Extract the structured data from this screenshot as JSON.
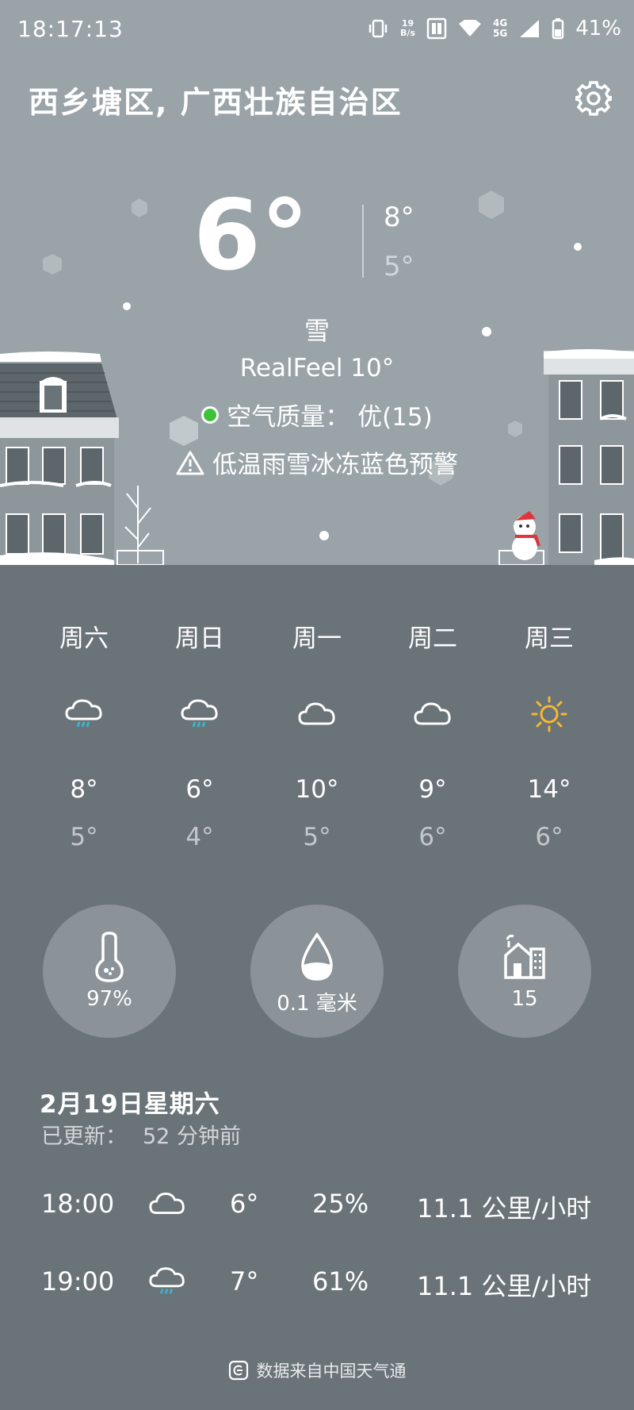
{
  "status": {
    "time": "18:17:13",
    "net_top": "19",
    "net_bottom": "B/s",
    "lte_top": "4G",
    "lte_bottom": "5G",
    "battery": "41%"
  },
  "header": {
    "location": "西乡塘区, 广西壮族自治区"
  },
  "current": {
    "temp": "6°",
    "high": "8°",
    "low": "5°",
    "condition": "雪",
    "realfeel": "RealFeel 10°",
    "air_quality": "空气质量： 优(15)",
    "warning": "低温雨雪冰冻蓝色预警"
  },
  "forecast": [
    {
      "day": "周六",
      "icon": "rain-icon",
      "high": "8°",
      "low": "5°"
    },
    {
      "day": "周日",
      "icon": "rain-icon",
      "high": "6°",
      "low": "4°"
    },
    {
      "day": "周一",
      "icon": "cloud-icon",
      "high": "10°",
      "low": "5°"
    },
    {
      "day": "周二",
      "icon": "cloud-icon",
      "high": "9°",
      "low": "6°"
    },
    {
      "day": "周三",
      "icon": "sun-icon",
      "high": "14°",
      "low": "6°"
    }
  ],
  "metrics": {
    "humidity": "97%",
    "precipitation": "0.1 毫米",
    "aqi": "15"
  },
  "today": {
    "date": "2月19日星期六",
    "updated_label": "已更新：",
    "updated_value": "52 分钟前"
  },
  "hourly": [
    {
      "time": "18:00",
      "icon": "cloud-icon",
      "temp": "6°",
      "pct": "25%",
      "wind": "11.1 公里/小时"
    },
    {
      "time": "19:00",
      "icon": "rain-icon",
      "temp": "7°",
      "pct": "61%",
      "wind": "11.1 公里/小时"
    }
  ],
  "footer": {
    "source": "数据来自中国天气通"
  },
  "colors": {
    "sky": "#99a3a8",
    "ground": "#6a7378",
    "circle": "#8b9398",
    "rain_drops": "#3cb4c8",
    "sun": "#f6b830",
    "aq_good": "#3ec13a"
  }
}
